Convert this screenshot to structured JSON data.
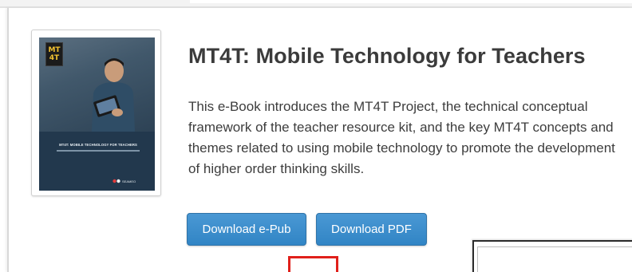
{
  "book": {
    "title": "MT4T: Mobile Technology for Teachers",
    "description": "This e-Book introduces the MT4T Project, the technical conceptual framework of the teacher resource kit, and the key MT4T concepts and themes related to using mobile technology to promote the development of higher order thinking skills.",
    "cover": {
      "logo_line1": "MT",
      "logo_line2": "4T",
      "title": "MT4T: MOBILE TECHNOLOGY FOR TEACHERS",
      "brand": "SEAMEO"
    }
  },
  "actions": {
    "download_epub_label": "Download e-Pub",
    "download_pdf_label": "Download PDF"
  },
  "colors": {
    "button": "#3b8cc9",
    "highlight_box": "#e0201b",
    "cover_band": "#22384d"
  }
}
